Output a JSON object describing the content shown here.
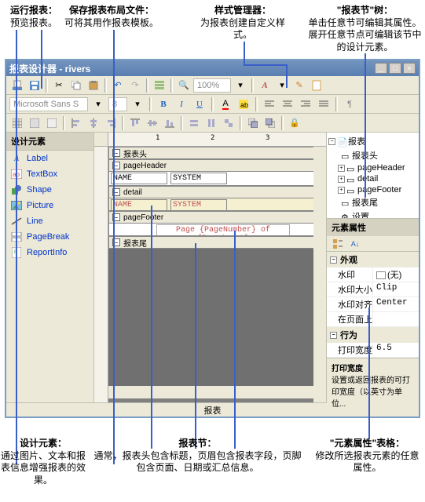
{
  "callouts": {
    "run_report": {
      "title": "运行报表：",
      "desc": "预览报表。"
    },
    "save_layout": {
      "title": "保存报表布局文件：",
      "desc": "可将其用作报表模板。"
    },
    "style_manager": {
      "title": "样式管理器：",
      "desc": "为报表创建自定义样式。"
    },
    "tree": {
      "title": "\"报表节\"树：",
      "desc": "单击任意节可编辑其属性。展开任意节点可编辑该节中的设计元素。"
    },
    "design_elements": {
      "title": "设计元素：",
      "desc": "通过图片、文本和报表信息增强报表的效果。"
    },
    "sections": {
      "title": "报表节：",
      "desc": "通常，报表头包含标题，页眉包含报表字段，页脚包含页面、日期或汇总信息。"
    },
    "props_grid": {
      "title": "\"元素属性\"表格：",
      "desc": "修改所选报表元素的任意属性。"
    }
  },
  "window": {
    "title": "报表设计器 - rivers"
  },
  "toolbar": {
    "font_family": "Microsoft Sans S",
    "font_size": "8",
    "zoom": "100%"
  },
  "left_panel": {
    "header": "设计元素",
    "items": [
      {
        "icon": "A",
        "label": "Label"
      },
      {
        "icon": "ab",
        "label": "TextBox"
      },
      {
        "icon": "□",
        "label": "Shape"
      },
      {
        "icon": "▣",
        "label": "Picture"
      },
      {
        "icon": "╱",
        "label": "Line"
      },
      {
        "icon": "⎯",
        "label": "PageBreak"
      },
      {
        "icon": "i",
        "label": "ReportInfo"
      }
    ]
  },
  "sections": {
    "report_head": "报表头",
    "page_header": "pageHeader",
    "detail": "detail",
    "page_footer": "pageFooter",
    "report_tail": "报表尾",
    "field_name": "NAME",
    "field_system": "SYSTEM",
    "page_expr": "Page {PageNumber} of {PageCount}"
  },
  "tree": {
    "root": "报表",
    "nodes": [
      "报表头",
      "pageHeader",
      "detail",
      "pageFooter",
      "报表尾",
      "设置"
    ]
  },
  "props": {
    "header": "元素属性",
    "cat_appearance": "外观",
    "watermark": {
      "name": "水印",
      "val": "(无)"
    },
    "watermark_size": {
      "name": "水印大小",
      "val": "Clip"
    },
    "watermark_align": {
      "name": "水印对齐",
      "val": "Center"
    },
    "on_front": {
      "name": "在页面上",
      "val": ""
    },
    "cat_behavior": "行为",
    "print_width": {
      "name": "打印宽度",
      "val": "6.5"
    },
    "desc_title": "打印宽度",
    "desc_body": "设置或返回报表的可打印宽度（以英寸为单位..."
  },
  "statusbar": "报表"
}
